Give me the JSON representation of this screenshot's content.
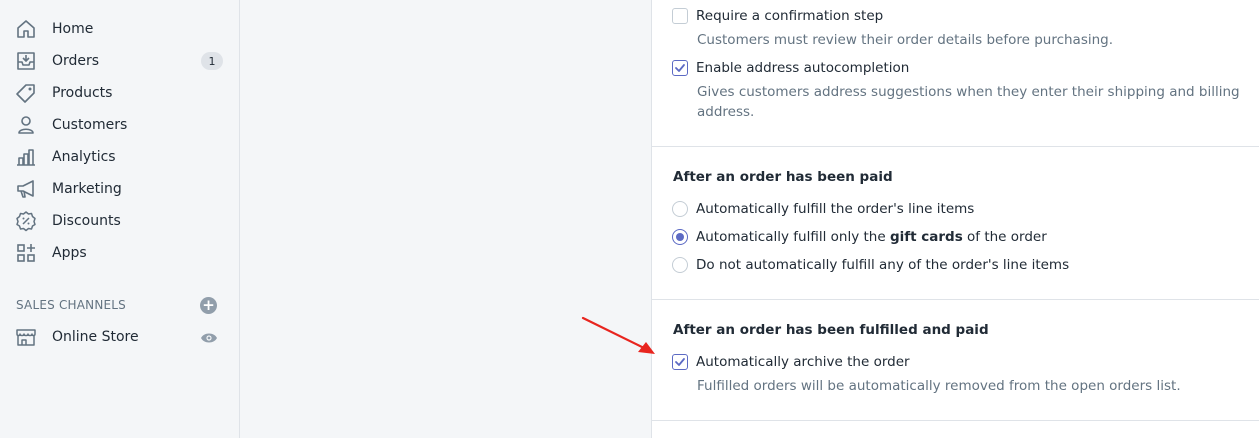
{
  "sidebar": {
    "items": [
      {
        "label": "Home",
        "icon": "home-icon"
      },
      {
        "label": "Orders",
        "icon": "orders-icon",
        "badge": "1"
      },
      {
        "label": "Products",
        "icon": "tag-icon"
      },
      {
        "label": "Customers",
        "icon": "person-icon"
      },
      {
        "label": "Analytics",
        "icon": "bar-chart-icon"
      },
      {
        "label": "Marketing",
        "icon": "megaphone-icon"
      },
      {
        "label": "Discounts",
        "icon": "discount-icon"
      },
      {
        "label": "Apps",
        "icon": "apps-icon"
      }
    ],
    "sales_channels_heading": "SALES CHANNELS",
    "channels": [
      {
        "label": "Online Store",
        "icon": "store-icon"
      }
    ]
  },
  "settings": {
    "confirmation": {
      "label": "Require a confirmation step",
      "help": "Customers must review their order details before purchasing.",
      "checked": false
    },
    "autocomplete": {
      "label": "Enable address autocompletion",
      "help_line1": "Gives customers address suggestions when they enter their shipping and billing",
      "help_line2": "address.",
      "checked": true
    },
    "paid_section": {
      "heading": "After an order has been paid",
      "options": [
        {
          "pre": "Automatically fulfill the order's line items",
          "bold": "",
          "post": "",
          "selected": false
        },
        {
          "pre": "Automatically fulfill only the ",
          "bold": "gift cards",
          "post": " of the order",
          "selected": true
        },
        {
          "pre": "Do not automatically fulfill any of the order's line items",
          "bold": "",
          "post": "",
          "selected": false
        }
      ]
    },
    "fulfilled_section": {
      "heading": "After an order has been fulfilled and paid",
      "archive_label": "Automatically archive the order",
      "archive_help": "Fulfilled orders will be automatically removed from the open orders list.",
      "checked": true
    }
  },
  "colors": {
    "accent": "#5c6ac4",
    "annotation_arrow": "#e8251f"
  }
}
